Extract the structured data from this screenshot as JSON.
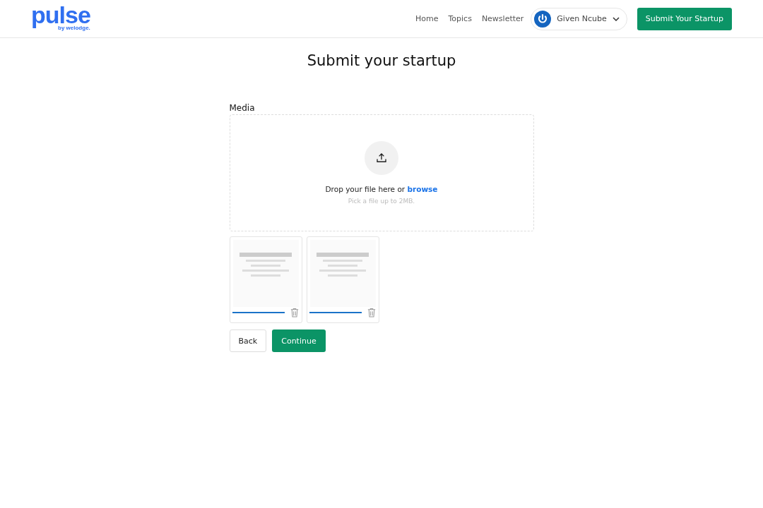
{
  "header": {
    "logo": {
      "title": "pulse",
      "subtitle": "by welodge."
    },
    "nav": [
      "Home",
      "Topics",
      "Newsletter"
    ],
    "user": {
      "name": "Given Ncube"
    },
    "cta": "Submit Your Startup"
  },
  "page_title": "Submit your startup",
  "media": {
    "label": "Media",
    "dropzone": {
      "text": "Drop your file here or ",
      "link": "browse",
      "hint": "Pick a file up to 2MB."
    },
    "files": [
      {
        "level": 1
      },
      {
        "level": 1
      }
    ]
  },
  "buttons": {
    "back": "Back",
    "continue": "Continue"
  }
}
